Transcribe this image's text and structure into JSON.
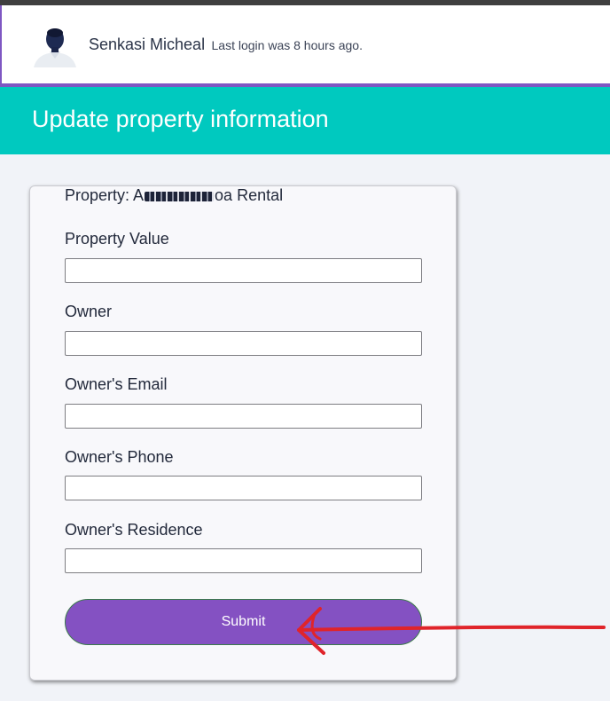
{
  "header": {
    "user_name": "Senkasi Micheal",
    "last_login": "Last login was 8 hours ago."
  },
  "banner": {
    "title": "Update property information"
  },
  "form": {
    "property_prefix": "Property: A",
    "property_suffix": "oa Rental",
    "fields": [
      {
        "label": "Property Value",
        "value": ""
      },
      {
        "label": "Owner",
        "value": ""
      },
      {
        "label": "Owner's Email",
        "value": ""
      },
      {
        "label": "Owner's Phone",
        "value": ""
      },
      {
        "label": "Owner's Residence",
        "value": ""
      }
    ],
    "submit_label": "Submit"
  },
  "colors": {
    "accent": "#8451c2",
    "banner": "#00c9bf",
    "annotation": "#e0242a"
  }
}
